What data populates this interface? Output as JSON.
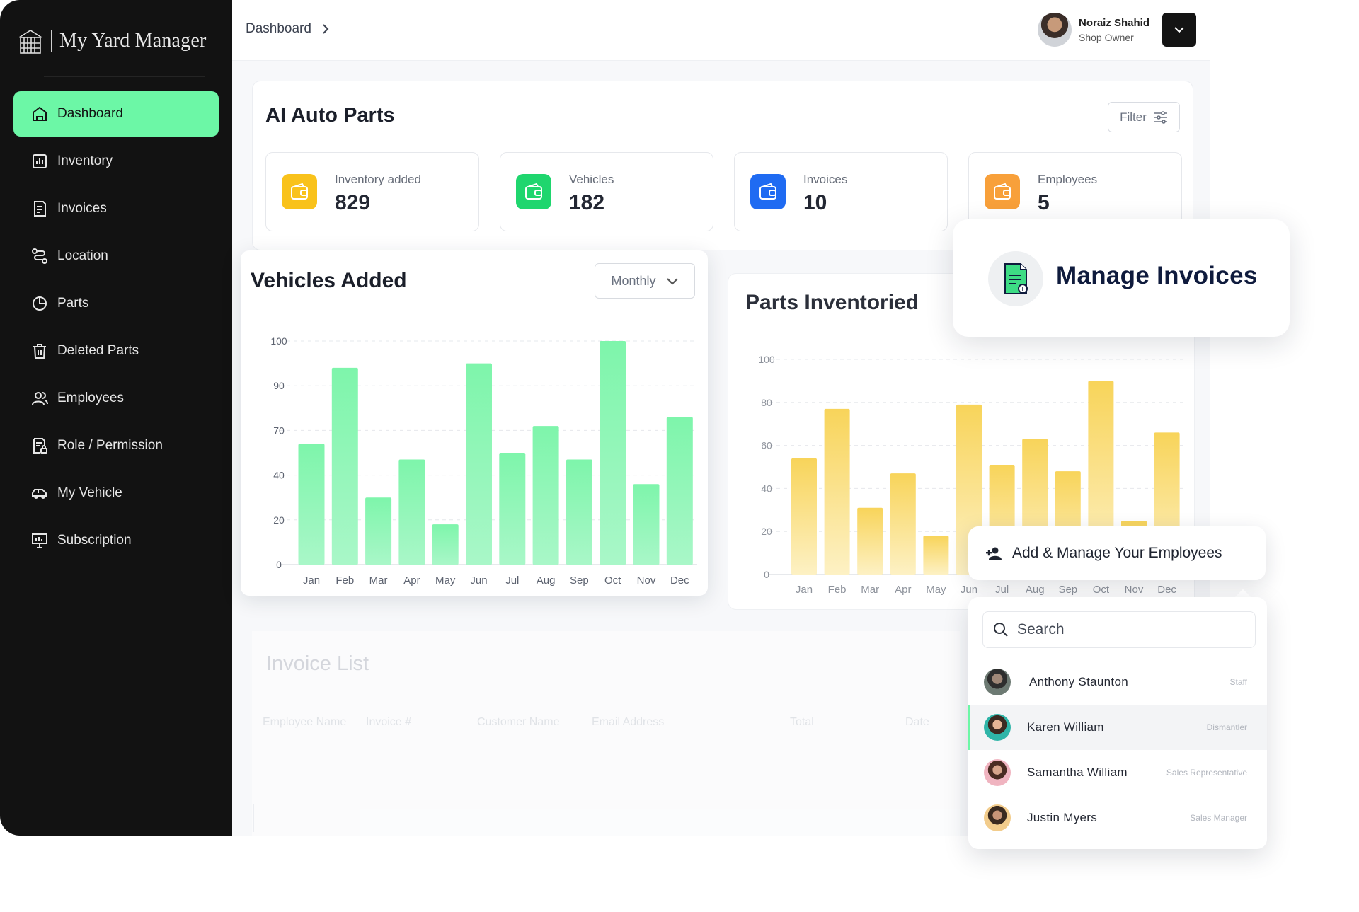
{
  "app": {
    "name": "My Yard Manager"
  },
  "sidebar": {
    "items": [
      {
        "label": "Dashboard",
        "icon": "home-icon",
        "active": true
      },
      {
        "label": "Inventory",
        "icon": "bar-chart-icon"
      },
      {
        "label": "Invoices",
        "icon": "document-icon"
      },
      {
        "label": "Location",
        "icon": "route-icon"
      },
      {
        "label": "Parts",
        "icon": "pie-chart-icon"
      },
      {
        "label": "Deleted Parts",
        "icon": "trash-icon"
      },
      {
        "label": "Employees",
        "icon": "users-icon"
      },
      {
        "label": "Role / Permission",
        "icon": "document-lock-icon"
      },
      {
        "label": "My Vehicle",
        "icon": "car-icon"
      },
      {
        "label": "Subscription",
        "icon": "presentation-icon"
      }
    ]
  },
  "header": {
    "breadcrumb": "Dashboard",
    "user": {
      "name": "Noraiz Shahid",
      "role": "Shop Owner"
    }
  },
  "shop": {
    "title": "AI Auto Parts",
    "filter_label": "Filter",
    "stats": [
      {
        "label": "Inventory added",
        "value": "829",
        "color": "#f9c21b"
      },
      {
        "label": "Vehicles",
        "value": "182",
        "color": "#1fd66e"
      },
      {
        "label": "Invoices",
        "value": "10",
        "color": "#1f6bf2"
      },
      {
        "label": "Employees",
        "value": "5",
        "color": "#f8a03a"
      }
    ]
  },
  "vehicles_chart": {
    "title": "Vehicles Added",
    "period": "Monthly"
  },
  "parts_chart": {
    "title": "Parts Inventoried"
  },
  "invoice_list": {
    "title": "Invoice List",
    "columns": [
      "Employee Name",
      "Invoice #",
      "Customer Name",
      "Email Address",
      "Total",
      "Date"
    ]
  },
  "manage_invoices": {
    "label": "Manage Invoices"
  },
  "employees_popup": {
    "title": "Add & Manage Your Employees",
    "search_placeholder": "Search",
    "employees": [
      {
        "name": "Anthony Staunton",
        "role": "Staff"
      },
      {
        "name": "Karen William",
        "role": "Dismantler"
      },
      {
        "name": "Samantha William",
        "role": "Sales Representative"
      },
      {
        "name": "Justin Myers",
        "role": "Sales Manager"
      }
    ]
  },
  "chart_data": [
    {
      "type": "bar",
      "title": "Vehicles Added",
      "categories": [
        "Jan",
        "Feb",
        "Mar",
        "Apr",
        "May",
        "Jun",
        "Jul",
        "Aug",
        "Sep",
        "Oct",
        "Nov",
        "Dec"
      ],
      "values": [
        54,
        88,
        30,
        47,
        18,
        90,
        50,
        62,
        47,
        100,
        36,
        66
      ],
      "y_ticks": [
        "0",
        "20",
        "40",
        "70",
        "90",
        "100"
      ],
      "grid": true,
      "color": "#6cf7a6"
    },
    {
      "type": "bar",
      "title": "Parts Inventoried",
      "categories": [
        "Jan",
        "Feb",
        "Mar",
        "Apr",
        "May",
        "Jun",
        "Jul",
        "Aug",
        "Sep",
        "Oct",
        "Nov",
        "Dec"
      ],
      "values": [
        54,
        77,
        31,
        47,
        18,
        79,
        51,
        63,
        48,
        90,
        25,
        66
      ],
      "y_ticks": [
        "0",
        "20",
        "40",
        "60",
        "80",
        "100"
      ],
      "ylim": [
        0,
        100
      ],
      "grid": true,
      "color": "#f9d24a"
    }
  ]
}
